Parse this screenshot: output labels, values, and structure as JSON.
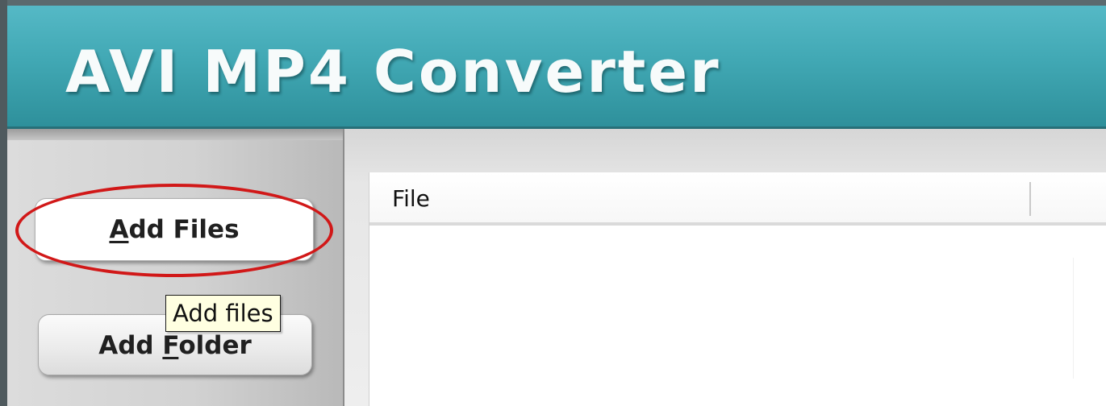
{
  "window": {
    "title": "AVI MP4 Converter"
  },
  "sidebar": {
    "add_files_button": {
      "label_access_key": "A",
      "label_rest": "dd Files",
      "tooltip": "Add files"
    },
    "add_folder_button": {
      "label_prefix": "Add ",
      "label_access_key": "F",
      "label_rest": "older"
    }
  },
  "file_list": {
    "columns": [
      "File"
    ],
    "rows": []
  },
  "annotation": {
    "highlight_color": "#d11818",
    "highlight_target": "add-files-button"
  },
  "colors": {
    "header_accent": "#41a8b4",
    "tooltip_background": "#ffffe1"
  }
}
